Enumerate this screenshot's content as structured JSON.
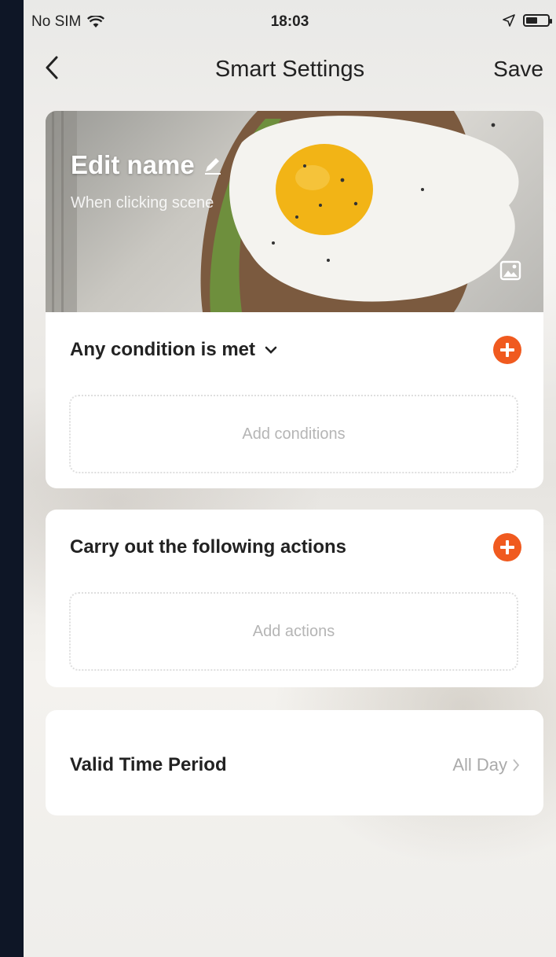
{
  "status_bar": {
    "carrier": "No SIM",
    "time": "18:03",
    "battery_level": 0.55
  },
  "nav": {
    "title": "Smart Settings",
    "save_label": "Save"
  },
  "cover": {
    "name_label": "Edit name",
    "subtitle": "When clicking  scene"
  },
  "conditions": {
    "header": "Any condition is met",
    "placeholder": "Add conditions"
  },
  "actions": {
    "header": "Carry out the following actions",
    "placeholder": "Add actions"
  },
  "time_period": {
    "label": "Valid Time Period",
    "value": "All Day"
  },
  "colors": {
    "accent": "#f05a1f",
    "frame": "#0e1626"
  },
  "icons": [
    "back-chevron-icon",
    "wifi-icon",
    "location-arrow-icon",
    "battery-icon",
    "pencil-icon",
    "image-icon",
    "chevron-down-icon",
    "plus-icon",
    "chevron-right-icon"
  ]
}
